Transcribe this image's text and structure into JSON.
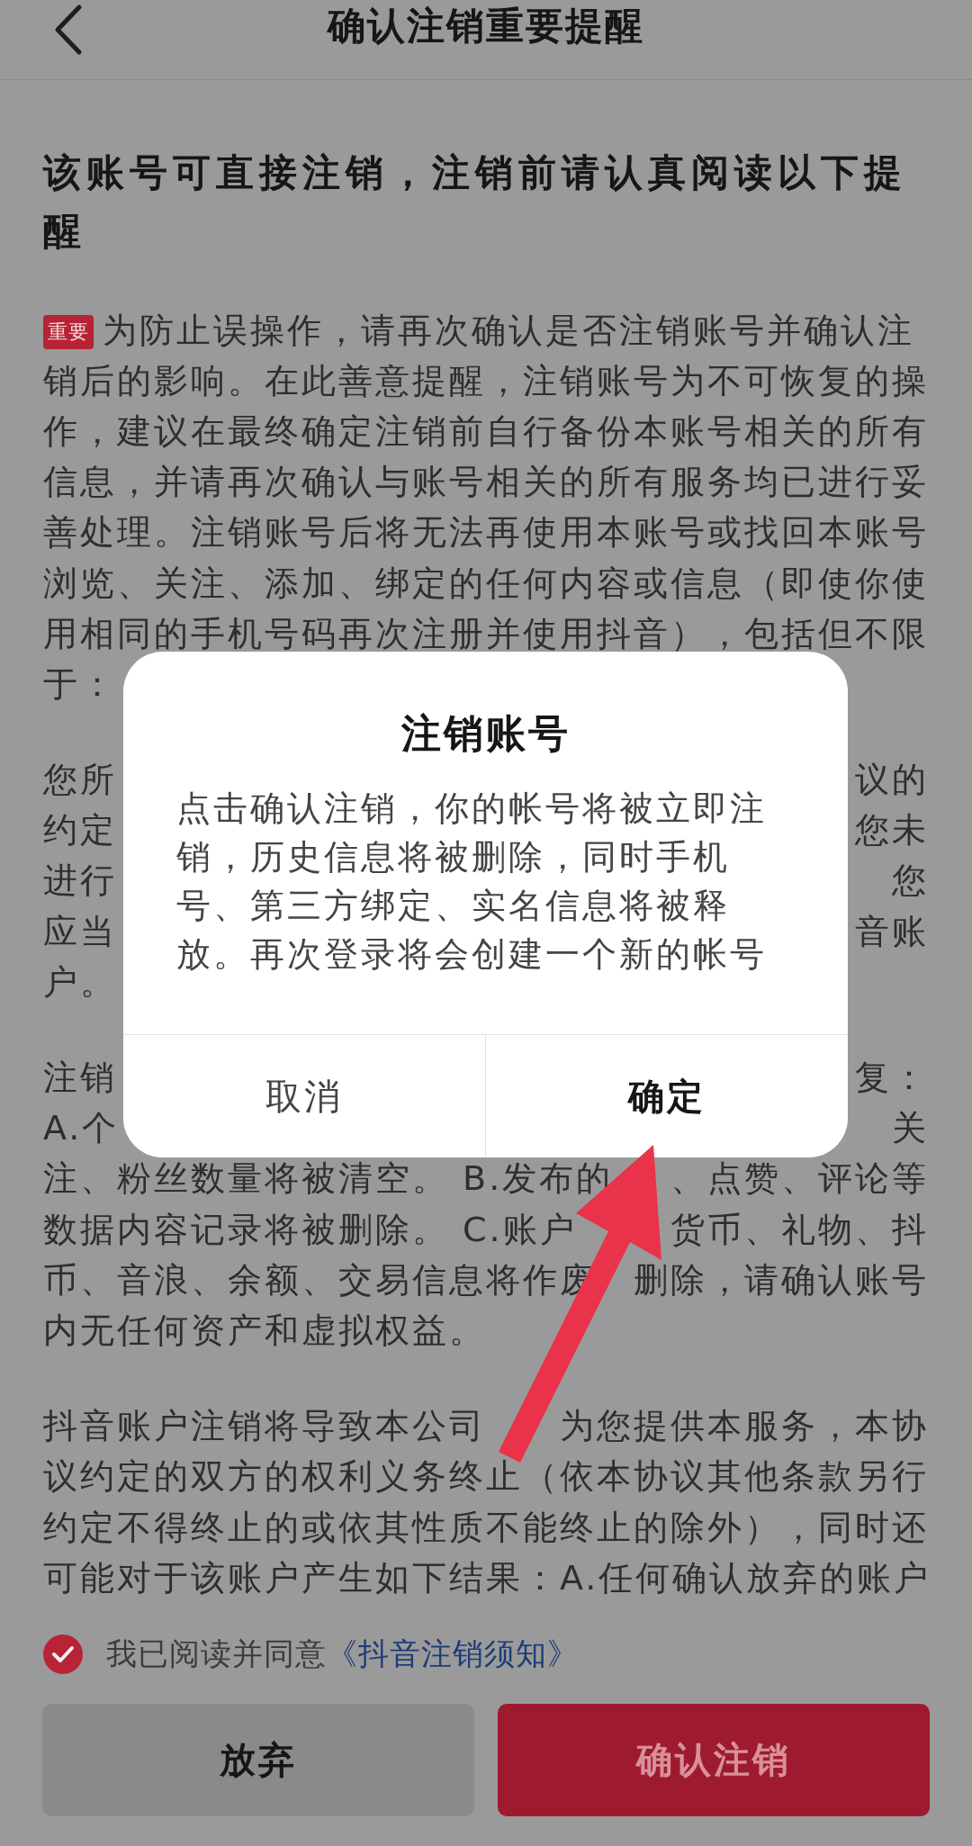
{
  "nav": {
    "title": "确认注销重要提醒"
  },
  "heading": "该账号可直接注销，注销前请认真阅读以下提醒",
  "paragraphs": [
    {
      "badge": "重要",
      "lines": [
        {
          "text": "为防止误操作，请再次确认是否注销账号并确认注"
        },
        {
          "text": "销后的影响。在此善意提醒，注销账号为不可恢复的操"
        },
        {
          "text": "作，建议在最终确定注销前自行备份本账号相关的所有"
        },
        {
          "text": "信息，并请再次确认与账号相关的所有服务均已进行妥"
        },
        {
          "text": "善处理。注销账号后将无法再使用本账号或找回本账号"
        },
        {
          "text": "浏览、关注、添加、绑定的任何内容或信息（即使你使"
        },
        {
          "text": "用相同的手机号码再次注册并使用抖音），包括但不限"
        },
        {
          "left": "于："
        }
      ]
    },
    {
      "lines": [
        {
          "left": "您所",
          "right": "议的"
        },
        {
          "left": "约定",
          "right": "您未"
        },
        {
          "left": "进行",
          "right": "您"
        },
        {
          "left": "应当",
          "right": "音账"
        },
        {
          "left": "户。"
        }
      ]
    },
    {
      "lines": [
        {
          "left": "注销",
          "right": "复："
        },
        {
          "left": "A.个",
          "right": "关"
        },
        {
          "left": "注、粉丝数量将被清空。 B.发布的",
          "right": "、点赞、评论等"
        },
        {
          "left": "数据内容记录将被删除。 C.账户",
          "right": "货币、礼物、抖"
        },
        {
          "left": "币、音浪、余额、交易信息将作废",
          "right": "删除，请确认账号"
        },
        {
          "text": "内无任何资产和虚拟权益。"
        }
      ]
    },
    {
      "lines": [
        {
          "left": "抖音账户注销将导致本公司",
          "right": "为您提供本服务，本协"
        },
        {
          "text": "议约定的双方的权利义务终止（依本协议其他条款另行"
        },
        {
          "text": "约定不得终止的或依其性质不能终止的除外），同时还"
        },
        {
          "text": "可能对于该账户产生如下结果：A.任何确认放弃的账户"
        }
      ]
    }
  ],
  "agreement": {
    "checked": true,
    "text": "我已阅读并同意",
    "link": "《抖音注销须知》"
  },
  "buttons": [
    {
      "label": "放弃",
      "kind": "secondary"
    },
    {
      "label": "确认注销",
      "kind": "primary"
    }
  ],
  "dialog": {
    "title": "注销账号",
    "message": "点击确认注销，你的帐号将被立即注销，历史信息将被删除，同时手机号、第三方绑定、实名信息将被释放。再次登录将会创建一个新的帐号",
    "buttons": [
      {
        "label": "取消",
        "kind": "cancel"
      },
      {
        "label": "确定",
        "kind": "confirm"
      }
    ]
  }
}
